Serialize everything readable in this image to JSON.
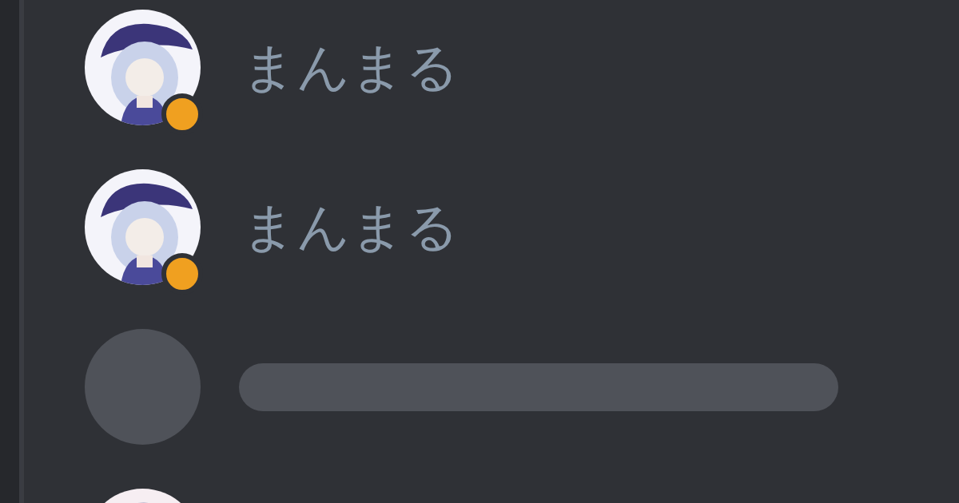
{
  "members": [
    {
      "kind": "user",
      "name": "まんまる",
      "color": "#f0a020"
    },
    {
      "kind": "user",
      "name": "まんまる",
      "color": "#f0a020"
    },
    {
      "kind": "loading"
    },
    {
      "kind": "avatar_only"
    }
  ]
}
